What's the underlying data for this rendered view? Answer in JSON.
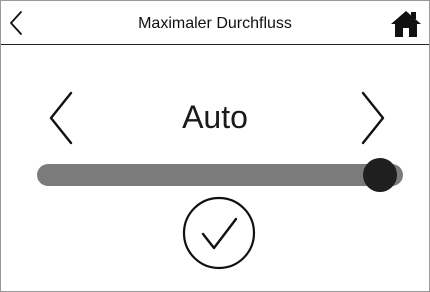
{
  "header": {
    "title": "Maximaler Durchfluss",
    "back_icon": "chevron-left-icon",
    "home_icon": "home-icon"
  },
  "selector": {
    "value": "Auto",
    "prev_icon": "chevron-left-icon",
    "next_icon": "chevron-right-icon"
  },
  "slider": {
    "level": 1.0
  },
  "confirm": {
    "icon": "checkmark-circle-icon"
  },
  "colors": {
    "background": "#ffffff",
    "text": "#111111",
    "track": "#7b7b7b",
    "thumb": "#1f1f1f"
  }
}
